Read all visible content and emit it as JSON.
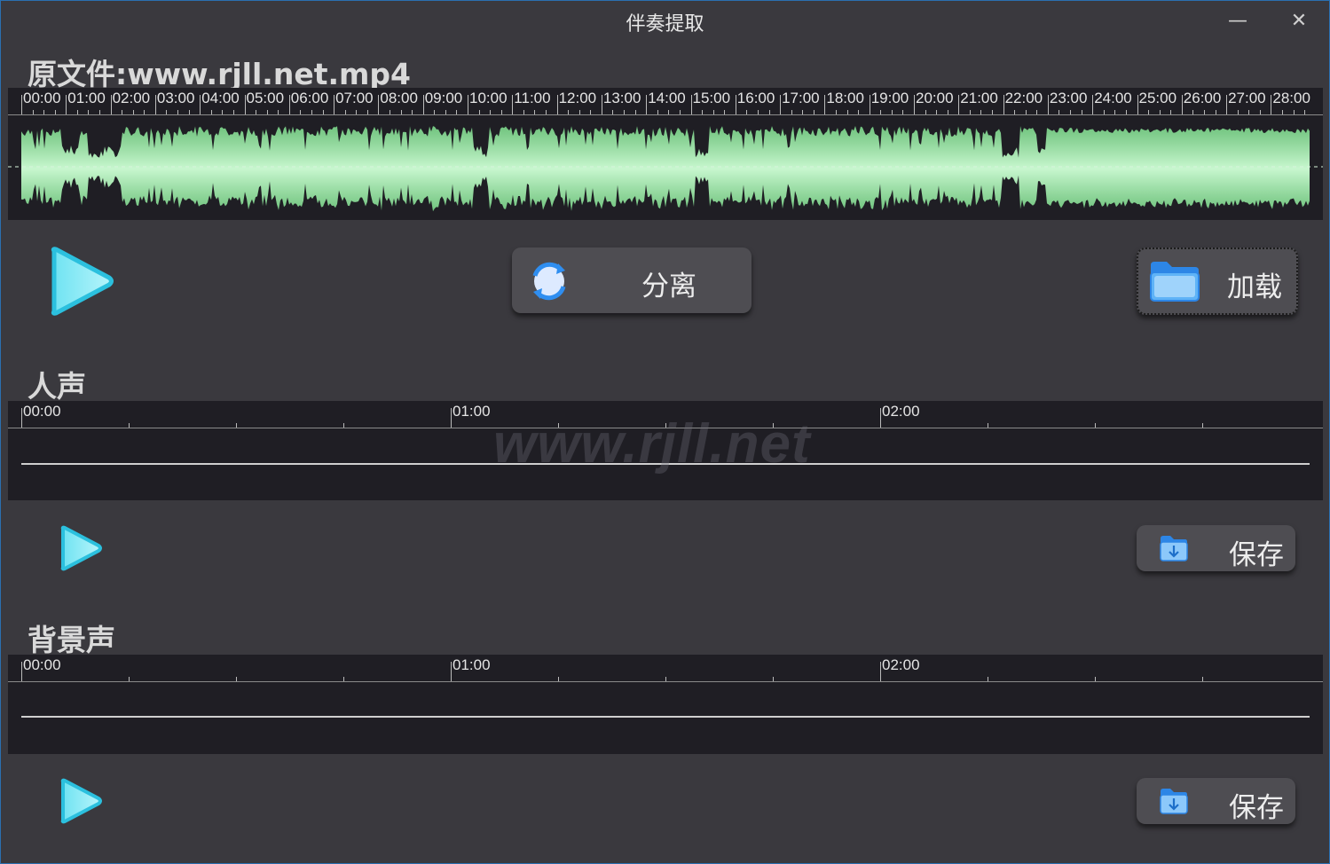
{
  "window": {
    "title": "伴奏提取",
    "minimize_glyph": "—",
    "close_glyph": "✕"
  },
  "source": {
    "title": "原文件:www.rjll.net.mp4",
    "ruler_labels": [
      "00:00",
      "01:00",
      "02:00",
      "03:00",
      "04:00",
      "05:00",
      "06:00",
      "07:00",
      "08:00",
      "09:00",
      "10:00",
      "11:00",
      "12:00",
      "13:00",
      "14:00",
      "15:00",
      "16:00",
      "17:00",
      "18:00",
      "19:00",
      "20:00",
      "21:00",
      "22:00",
      "23:00",
      "24:00",
      "25:00",
      "26:00",
      "27:00",
      "28:00"
    ],
    "waveform_color": "#7fe08e"
  },
  "actions": {
    "separate_label": "分离",
    "load_label": "加载"
  },
  "vocal": {
    "title": "人声",
    "ruler_labels": [
      "00:00",
      "01:00",
      "02:00"
    ],
    "save_label": "保存"
  },
  "background": {
    "title": "背景声",
    "ruler_labels": [
      "00:00",
      "01:00",
      "02:00"
    ],
    "save_label": "保存"
  },
  "watermark": "www.rjll.net",
  "icons": {
    "play": "play-triangle-icon",
    "separate": "refresh-icon",
    "load": "folder-icon",
    "save": "folder-download-icon"
  },
  "colors": {
    "play_accent": "#3ec9e6",
    "folder_accent": "#4aa3f0"
  }
}
